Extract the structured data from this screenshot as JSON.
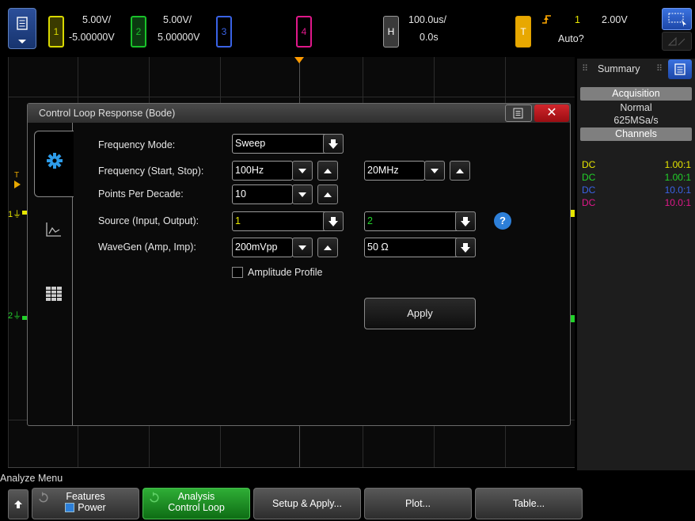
{
  "topbar": {
    "ch1": {
      "num": "1",
      "scale": "5.00V/",
      "offset": "-5.00000V",
      "color": "#d8d800"
    },
    "ch2": {
      "num": "2",
      "scale": "5.00V/",
      "offset": "5.00000V",
      "color": "#19c22a"
    },
    "ch3": {
      "num": "3",
      "color": "#3a63e6"
    },
    "ch4": {
      "num": "4",
      "color": "#e0188a"
    },
    "horiz": {
      "label": "H",
      "scale": "100.0us/",
      "delay": "0.0s"
    },
    "trigger": {
      "label": "T",
      "source": "1",
      "level": "2.00V",
      "mode": "Auto?"
    }
  },
  "side": {
    "tab_label": "Summary",
    "acq_header": "Acquisition",
    "acq_mode": "Normal",
    "acq_rate": "625MSa/s",
    "channels_header": "Channels",
    "channels": [
      {
        "coupling": "DC",
        "probe": "1.00:1",
        "color": "#e6e600"
      },
      {
        "coupling": "DC",
        "probe": "1.00:1",
        "color": "#22d22a"
      },
      {
        "coupling": "DC",
        "probe": "10.0:1",
        "color": "#3a63e6"
      },
      {
        "coupling": "DC",
        "probe": "10.0:1",
        "color": "#e0188a"
      }
    ]
  },
  "markers": {
    "trig_t": "T",
    "ch1": "1",
    "ch2": "2"
  },
  "dialog": {
    "title": "Control Loop Response (Bode)",
    "close": "✕",
    "rows": {
      "freq_mode": {
        "label": "Frequency Mode:",
        "value": "Sweep"
      },
      "freq": {
        "label": "Frequency (Start, Stop):",
        "start": "100Hz",
        "stop": "20MHz"
      },
      "ppd": {
        "label": "Points Per Decade:",
        "value": "10"
      },
      "source": {
        "label": "Source (Input, Output):",
        "input": "1",
        "output": "2"
      },
      "wavegen": {
        "label": "WaveGen (Amp, Imp):",
        "amp": "200mVpp",
        "imp": "50 Ω"
      }
    },
    "amplitude_profile": "Amplitude Profile",
    "apply": "Apply",
    "help": "?"
  },
  "bottom": {
    "menu_title": "Analyze Menu",
    "keys": [
      {
        "line1": "Features",
        "line2": "Power"
      },
      {
        "line1": "Analysis",
        "line2": "Control Loop"
      },
      {
        "line1": "Setup & Apply..."
      },
      {
        "line1": "Plot..."
      },
      {
        "line1": "Table..."
      }
    ]
  }
}
